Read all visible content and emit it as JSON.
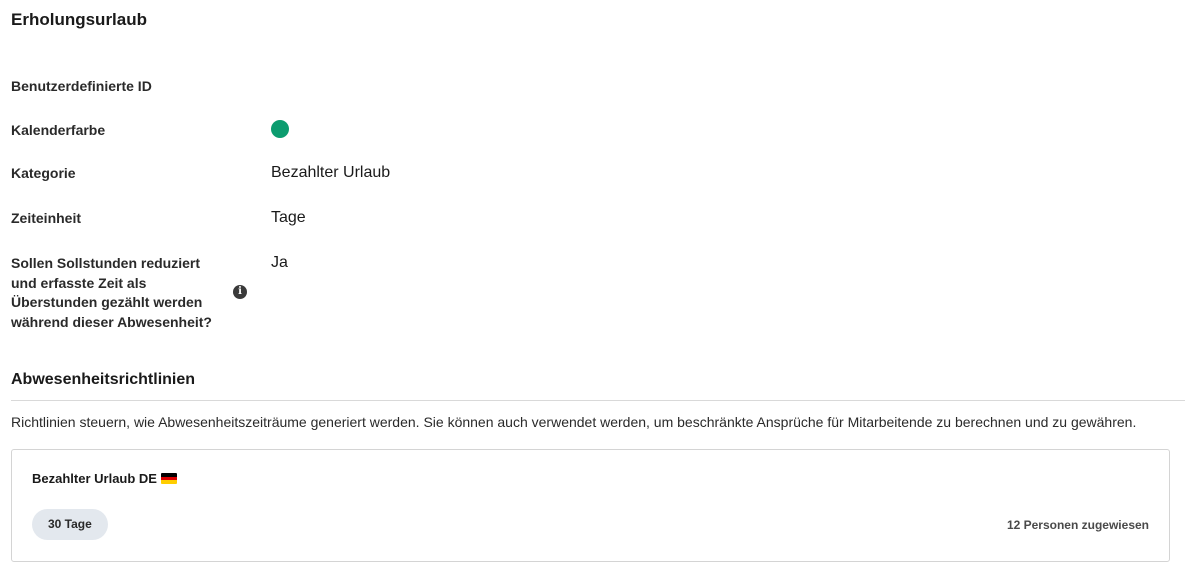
{
  "page": {
    "title": "Erholungsurlaub"
  },
  "details": {
    "custom_id_label": "Benutzerdefinierte ID",
    "custom_id_value": "",
    "calendar_color_label": "Kalenderfarbe",
    "calendar_color": "#0c9c6f",
    "category_label": "Kategorie",
    "category_value": "Bezahlter Urlaub",
    "time_unit_label": "Zeiteinheit",
    "time_unit_value": "Tage",
    "overtime_label": "Sollen Sollstunden reduziert und erfasste Zeit als Überstunden gezählt werden während dieser Abwesenheit?",
    "overtime_value": "Ja",
    "info_icon": "i"
  },
  "policies": {
    "title": "Abwesenheitsrichtlinien",
    "description": "Richtlinien steuern, wie Abwesenheitszeiträume generiert werden. Sie können auch verwendet werden, um beschränkte Ansprüche für Mitarbeitende zu berechnen und zu gewähren.",
    "cards": [
      {
        "name": "Bezahlter Urlaub DE",
        "flag_icon": "flag-germany-icon",
        "flag_colors": [
          "#000000",
          "#dd0000",
          "#ffce00"
        ],
        "amount": "30 Tage",
        "badge_color": "#e3e8ee",
        "assigned": "12 Personen zugewiesen"
      }
    ]
  }
}
